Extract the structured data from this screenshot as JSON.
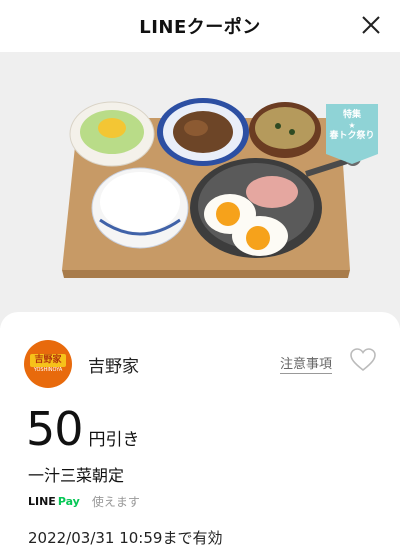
{
  "header": {
    "title": "LINEクーポン",
    "close_icon": "close-icon"
  },
  "hero": {
    "image_description_icon": "meal-photo",
    "campaign_tag": {
      "line1": "特集",
      "star": "★",
      "line2": "春トク祭り",
      "color": "#8fd3d6"
    }
  },
  "store": {
    "logo_text": "吉野家",
    "logo_sub": "YOSHINOYA",
    "name": "吉野家",
    "notes_link": "注意事項",
    "favorite_icon": "heart-icon"
  },
  "coupon": {
    "discount_value": "50",
    "discount_unit": "円引き",
    "product": "一汁三菜朝定"
  },
  "payment": {
    "logo_line": "LINE",
    "logo_pay": "Pay",
    "status": "使えます",
    "accent_color": "#06c755"
  },
  "expiry": "2022/03/31 10:59まで有効"
}
